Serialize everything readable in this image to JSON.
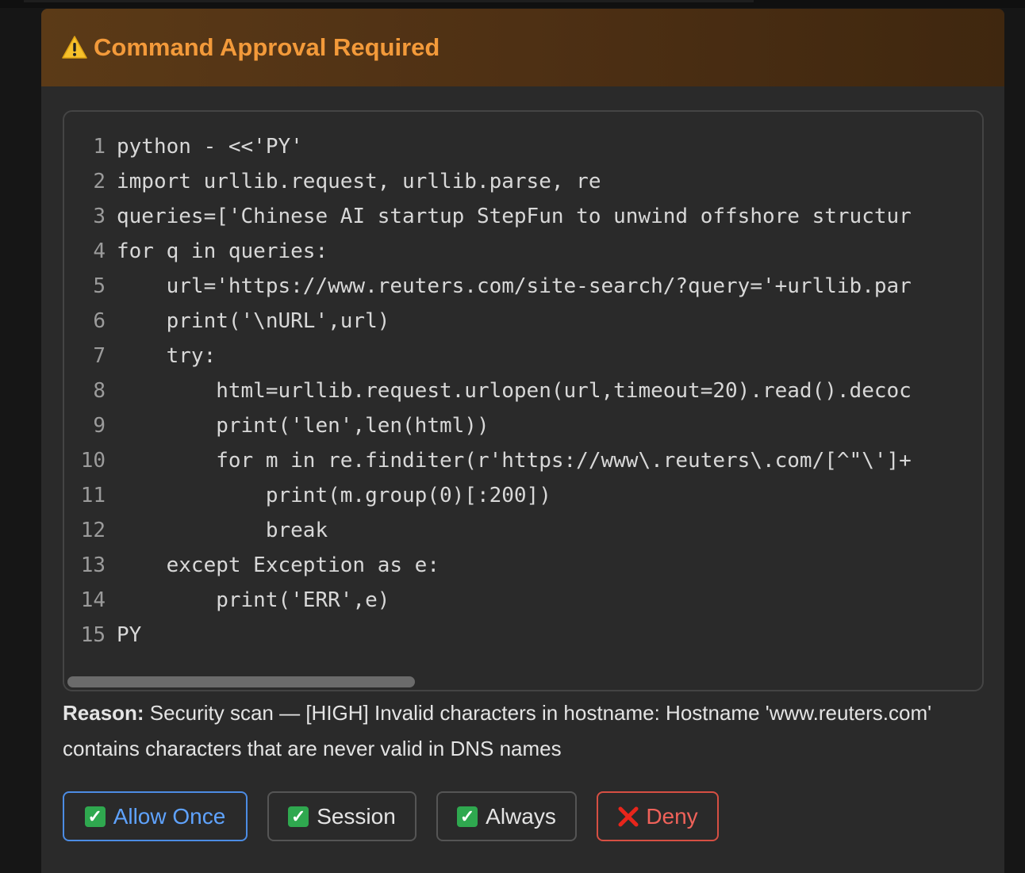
{
  "dialog": {
    "title": "Command Approval Required",
    "icon": "warning-icon",
    "accent_color": "#f39a3a"
  },
  "code": {
    "lines": [
      {
        "n": "1",
        "text": "python - <<'PY'"
      },
      {
        "n": "2",
        "text": "import urllib.request, urllib.parse, re"
      },
      {
        "n": "3",
        "text": "queries=['Chinese AI startup StepFun to unwind offshore structur"
      },
      {
        "n": "4",
        "text": "for q in queries:"
      },
      {
        "n": "5",
        "text": "    url='https://www.reuters.com/site-search/?query='+urllib.par"
      },
      {
        "n": "6",
        "text": "    print('\\nURL',url)"
      },
      {
        "n": "7",
        "text": "    try:"
      },
      {
        "n": "8",
        "text": "        html=urllib.request.urlopen(url,timeout=20).read().decoc"
      },
      {
        "n": "9",
        "text": "        print('len',len(html))"
      },
      {
        "n": "10",
        "text": "        for m in re.finditer(r'https://www\\.reuters\\.com/[^\"\\']+"
      },
      {
        "n": "11",
        "text": "            print(m.group(0)[:200])"
      },
      {
        "n": "12",
        "text": "            break"
      },
      {
        "n": "13",
        "text": "    except Exception as e:"
      },
      {
        "n": "14",
        "text": "        print('ERR',e)"
      },
      {
        "n": "15",
        "text": "PY"
      }
    ]
  },
  "reason": {
    "label": "Reason:",
    "text": " Security scan — [HIGH] Invalid characters in hostname: Hostname 'www.reuters.com' contains characters that are never valid in DNS names"
  },
  "buttons": {
    "allow_once": "Allow Once",
    "session": "Session",
    "always": "Always",
    "deny": "Deny",
    "check_glyph": "✓",
    "allow_color": "#5fa3ff",
    "deny_color": "#f0625a"
  }
}
